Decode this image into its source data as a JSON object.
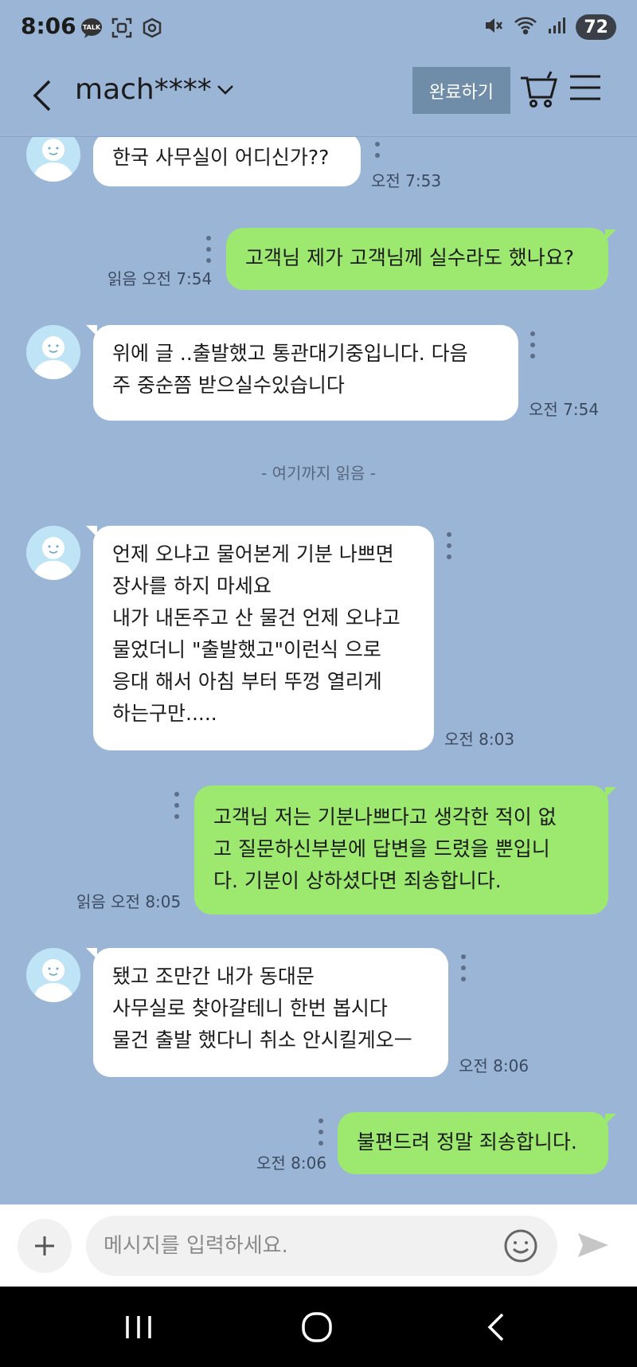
{
  "status_bar": {
    "time": "8:06",
    "battery": "72",
    "left_icons": [
      "kakaotalk-notification-icon",
      "screenshot-icon",
      "app-notification-icon"
    ],
    "right_icons": [
      "mute-icon",
      "wifi-icon",
      "signal-icon",
      "battery-icon"
    ]
  },
  "header": {
    "title": "mach****",
    "done_label": "완료하기",
    "icons": [
      "back-icon",
      "chevron-down-icon",
      "cart-icon",
      "menu-icon"
    ]
  },
  "messages": [
    {
      "side": "in",
      "lines": [
        "한국 사무실이 어디신가??"
      ],
      "time": "오전 7:53",
      "read": ""
    },
    {
      "side": "out",
      "lines": [
        "고객님 제가 고객님께 실수라도 했나요?"
      ],
      "time": "오전 7:54",
      "read": "읽음"
    },
    {
      "side": "in",
      "lines": [
        "위에 글 ..출발했고 통관대기중입니다. 다음",
        "주 중순쯤 받으실수있습니다"
      ],
      "time": "오전 7:54",
      "read": ""
    },
    {
      "side": "in",
      "lines": [
        "언제 오냐고 물어본게 기분 나쁘면",
        "장사를 하지 마세요",
        "내가 내돈주고 산 물건 언제 오냐고",
        "물었더니 \"출발했고\"이런식 으로",
        "응대 해서 아침 부터 뚜껑 열리게",
        "하는구만....."
      ],
      "time": "오전 8:03",
      "read": ""
    },
    {
      "side": "out",
      "lines": [
        "고객님 저는 기분나쁘다고 생각한 적이 없",
        "고 질문하신부분에 답변을 드렸을 뿐입니",
        "다. 기분이 상하셨다면 죄송합니다."
      ],
      "time": "오전 8:05",
      "read": "읽음"
    },
    {
      "side": "in",
      "lines": [
        "됐고 조만간 내가 동대문",
        "사무실로 찾아갈테니 한번 봅시다",
        "물건 출발 했다니 취소 안시킬게오ㅡ"
      ],
      "time": "오전 8:06",
      "read": ""
    },
    {
      "side": "out",
      "lines": [
        "불편드려 정말 죄송합니다."
      ],
      "time": "오전 8:06",
      "read": ""
    }
  ],
  "read_divider": "- 여기까지 읽음 -",
  "input": {
    "placeholder": "메시지를 입력하세요.",
    "icons": [
      "plus-icon",
      "emoji-icon",
      "send-icon"
    ]
  },
  "colors": {
    "background": "#9bb5d7",
    "incoming_bubble": "#ffffff",
    "outgoing_bubble": "#9de86f",
    "done_button": "#6f8ca8",
    "avatar": "#bfe4f5"
  }
}
